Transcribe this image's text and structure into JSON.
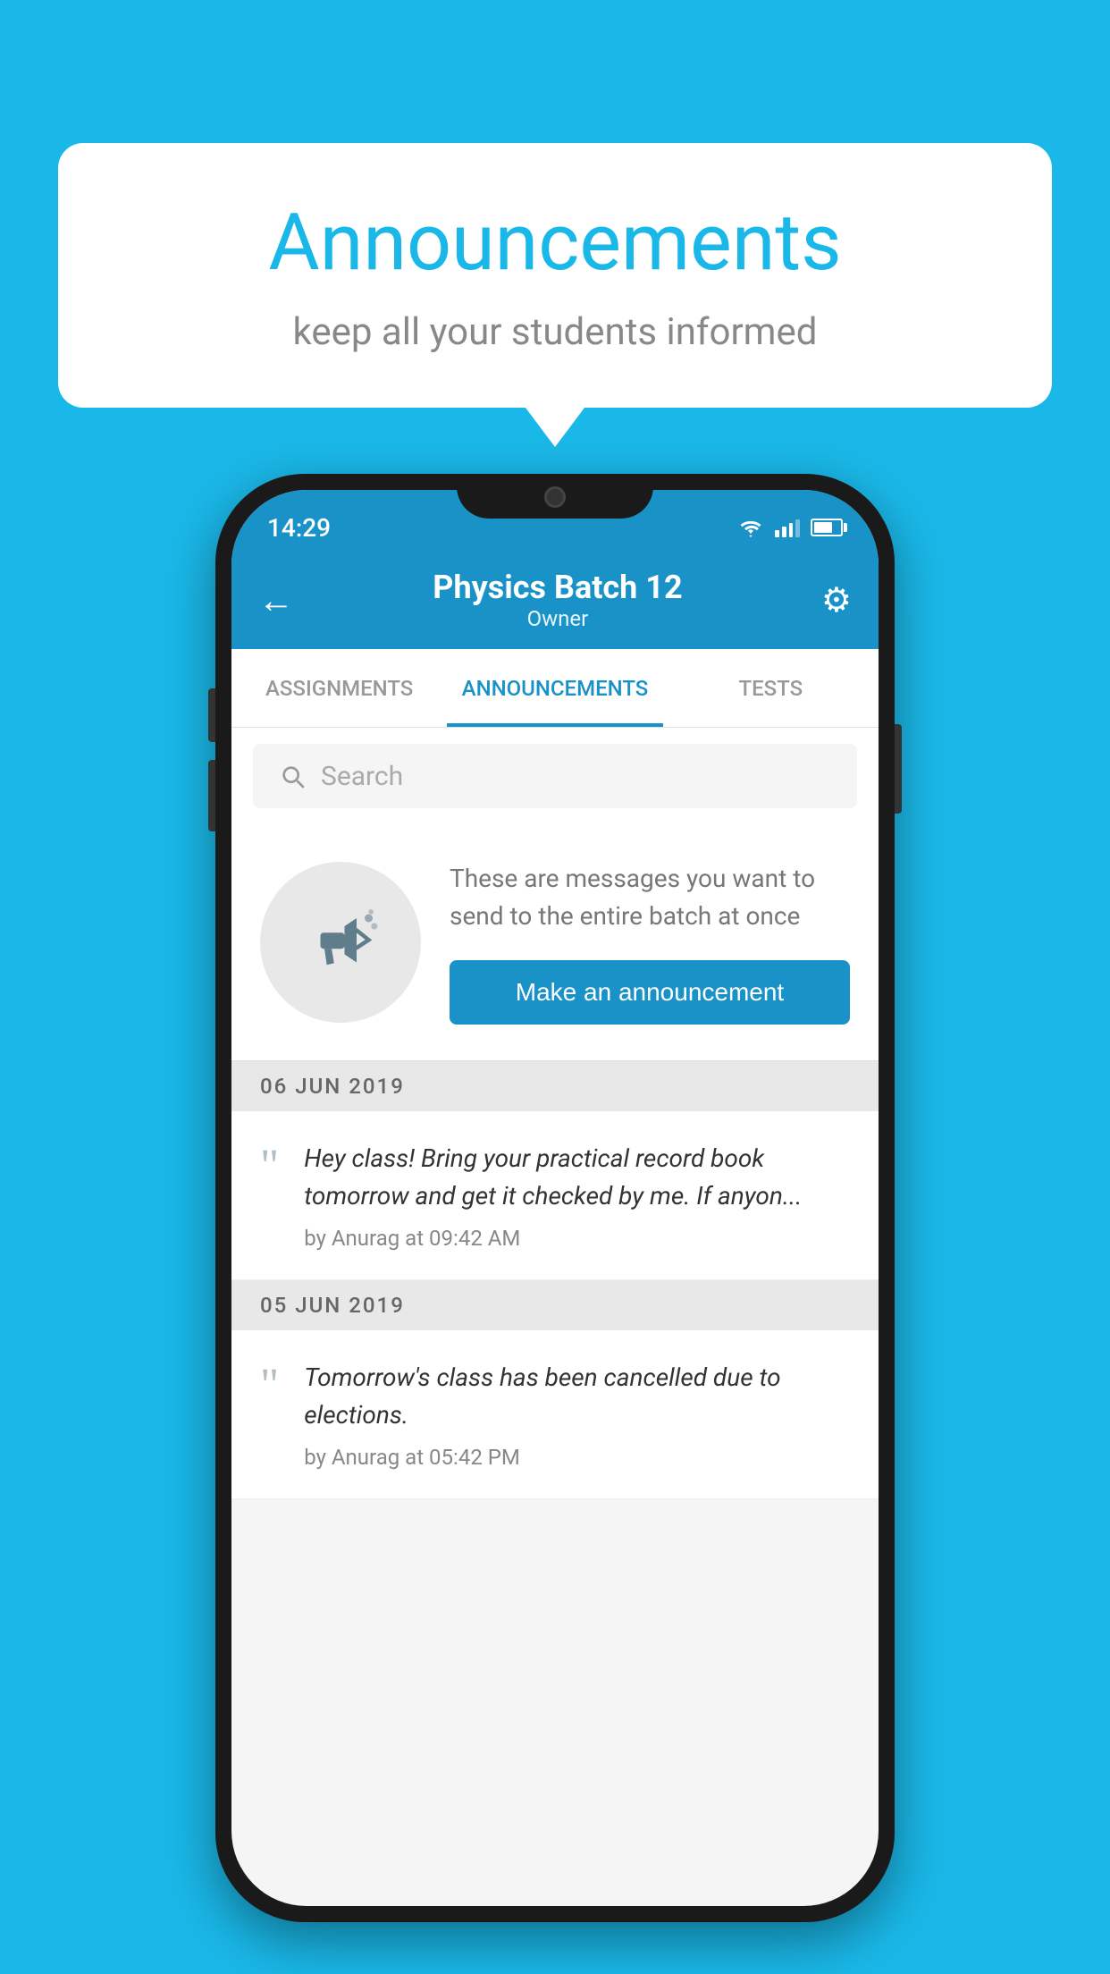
{
  "background": {
    "color": "#1ab8e8"
  },
  "speech_bubble": {
    "title": "Announcements",
    "subtitle": "keep all your students informed"
  },
  "phone": {
    "status_bar": {
      "time": "14:29"
    },
    "app_bar": {
      "title": "Physics Batch 12",
      "subtitle": "Owner",
      "back_label": "←",
      "gear_label": "⚙"
    },
    "tabs": [
      {
        "label": "ASSIGNMENTS",
        "active": false
      },
      {
        "label": "ANNOUNCEMENTS",
        "active": true
      },
      {
        "label": "TESTS",
        "active": false
      }
    ],
    "search": {
      "placeholder": "Search"
    },
    "announcement_prompt": {
      "description_text": "These are messages you want to send to the entire batch at once",
      "button_label": "Make an announcement"
    },
    "announcements": [
      {
        "date": "06  JUN  2019",
        "text": "Hey class! Bring your practical record book tomorrow and get it checked by me. If anyon...",
        "meta": "by Anurag at 09:42 AM"
      },
      {
        "date": "05  JUN  2019",
        "text": "Tomorrow's class has been cancelled due to elections.",
        "meta": "by Anurag at 05:42 PM"
      }
    ]
  }
}
